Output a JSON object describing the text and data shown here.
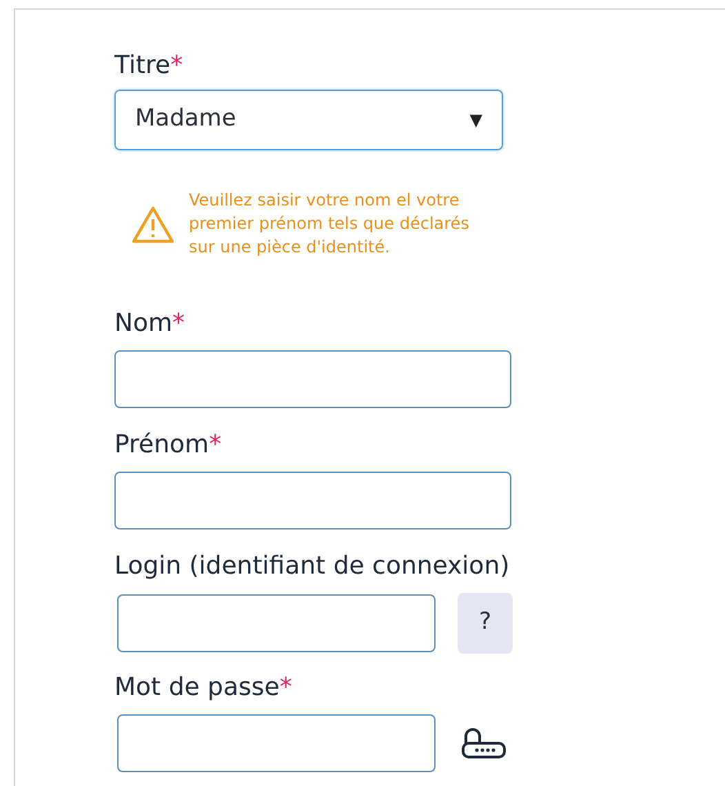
{
  "fields": [
    {
      "kind": "select",
      "label": "Titre",
      "required_mark": "*",
      "value": "Madame",
      "arrow": "▼"
    },
    {
      "kind": "notice",
      "text": "Veuillez saisir votre nom el votre premier prénom tels que déclarés sur une pièce d'identité."
    },
    {
      "kind": "text",
      "label": "Nom",
      "required_mark": "*"
    },
    {
      "kind": "text",
      "label": "Prénom",
      "required_mark": "*"
    },
    {
      "kind": "help",
      "label": "Login (identifiant de connexion)",
      "help": "?"
    },
    {
      "kind": "password",
      "label": "Mot de passe",
      "required_mark": "*"
    }
  ]
}
